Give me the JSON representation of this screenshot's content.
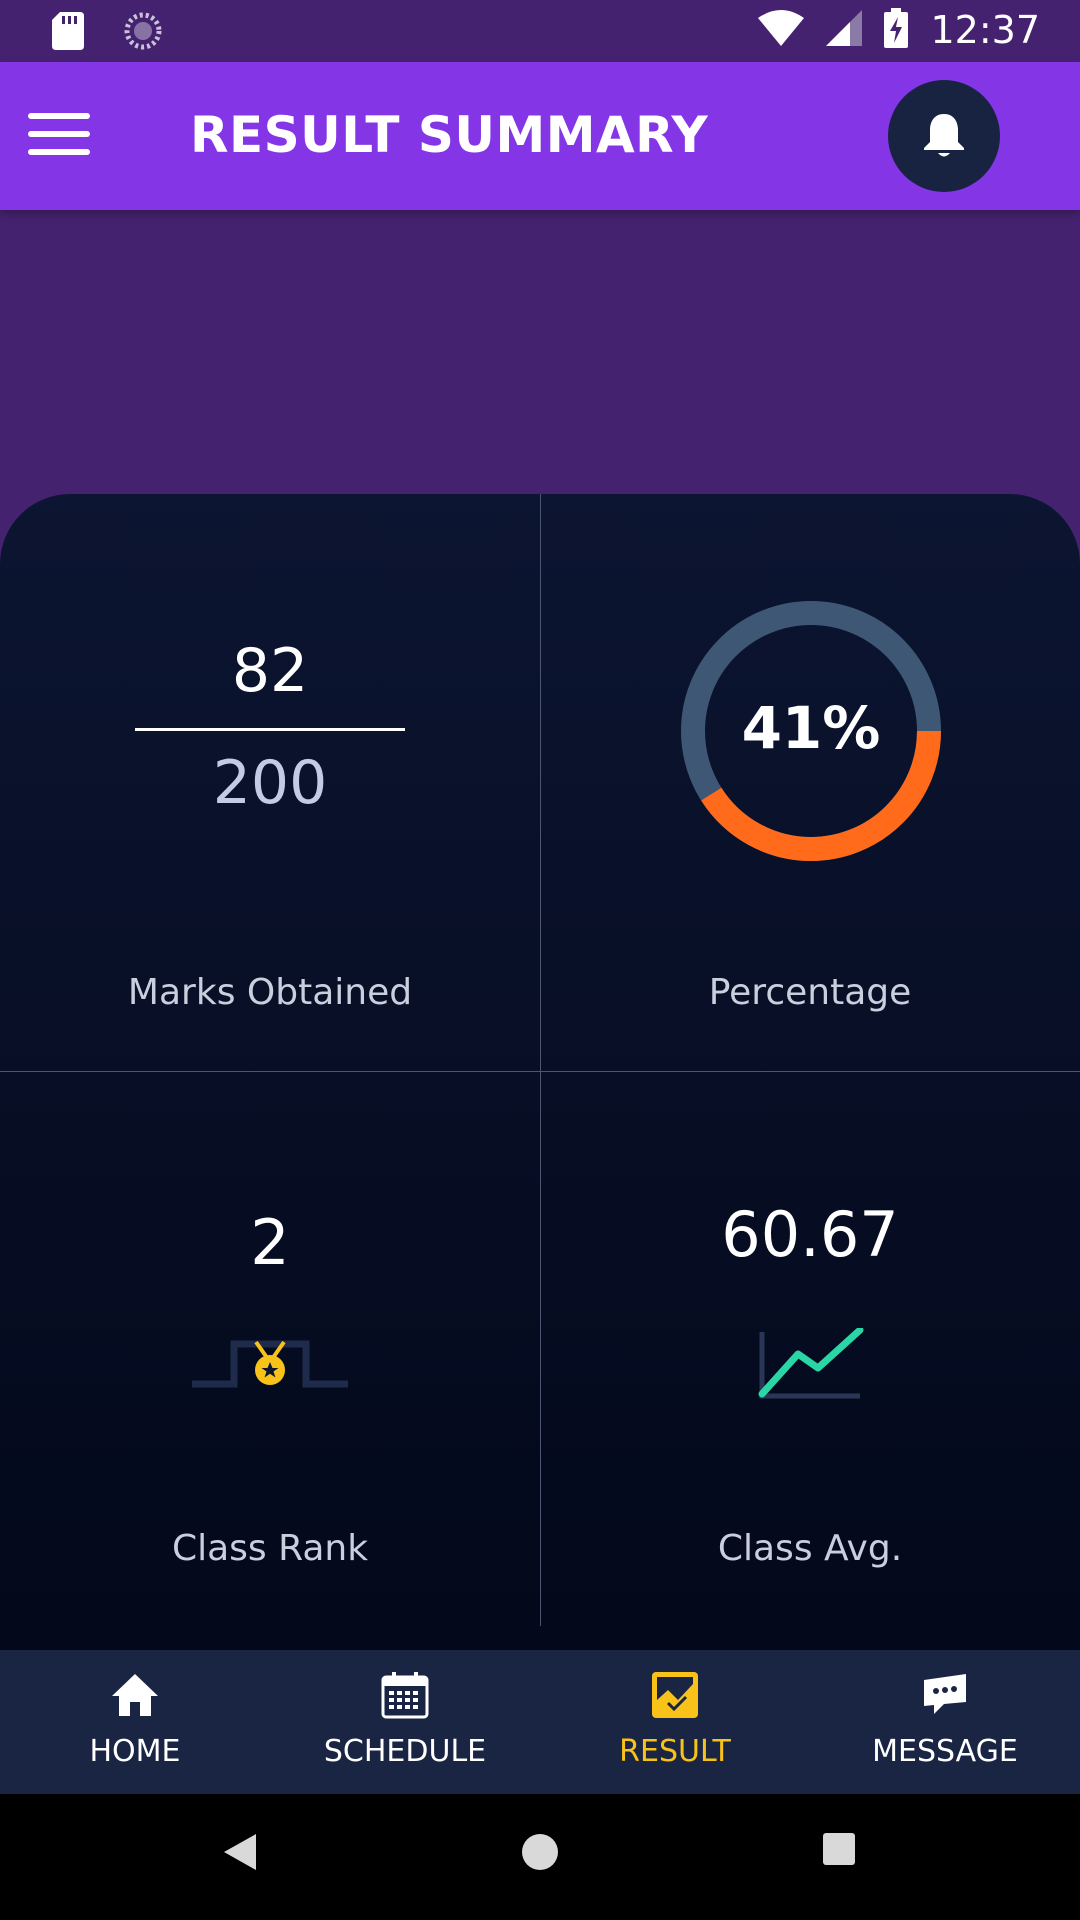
{
  "status_bar": {
    "time": "12:37",
    "icons": [
      "sd-card-icon",
      "sync-icon",
      "wifi-icon",
      "signal-icon",
      "battery-charging-icon"
    ]
  },
  "app_bar": {
    "title": "RESULT SUMMARY",
    "menu_icon": "hamburger-menu-icon",
    "notification_icon": "bell-icon"
  },
  "summary": {
    "marks": {
      "obtained": "82",
      "total": "200",
      "label": "Marks Obtained"
    },
    "percentage": {
      "value_text": "41%",
      "fraction": 0.41,
      "label": "Percentage"
    },
    "rank": {
      "value": "2",
      "label": "Class Rank",
      "icon": "podium-medal-icon"
    },
    "class_avg": {
      "value": "60.67",
      "label": "Class Avg.",
      "icon": "trend-chart-icon"
    }
  },
  "bottom_nav": {
    "items": [
      {
        "label": "HOME",
        "icon": "home-icon"
      },
      {
        "label": "SCHEDULE",
        "icon": "calendar-icon"
      },
      {
        "label": "RESULT",
        "icon": "result-chart-icon",
        "active": true
      },
      {
        "label": "MESSAGE",
        "icon": "message-icon"
      }
    ]
  },
  "colors": {
    "status_bar_bg": "#45226f",
    "app_bar_bg": "#8436e6",
    "card_bg": "#0c1531",
    "donut_track": "#3e5774",
    "donut_fill": "#ff6b1a",
    "active_nav": "#f9c218",
    "trend_line": "#2bd6a6",
    "medal": "#f9c218"
  }
}
